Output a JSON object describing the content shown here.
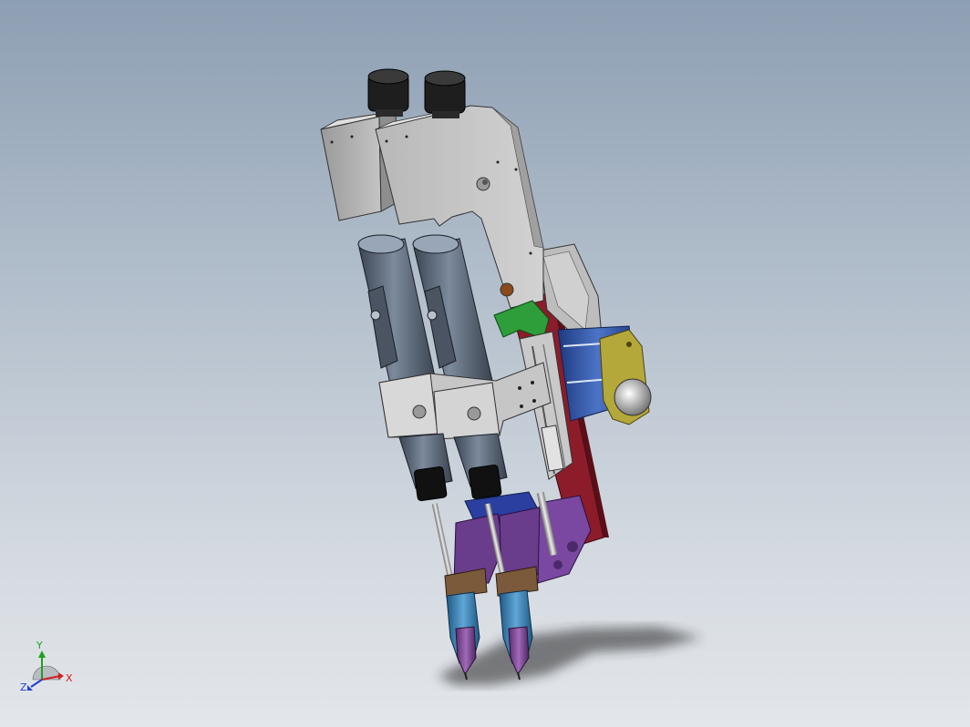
{
  "viewport": {
    "background_top": "#8d9fb3",
    "background_bottom": "#e3e6ea"
  },
  "model": {
    "frame_color": "#a8a8a8",
    "plate_color": "#8c1c2a",
    "bracket_color": "#6a3c8c",
    "motor_color": "#5b6878",
    "cylinder_color": "#2a4fa0",
    "flange_color": "#b5a83a",
    "bracket_accent_color": "#2d9e3a",
    "nozzle_color": "#3a7fb0"
  },
  "triad": {
    "x_label": "X",
    "y_label": "Y",
    "z_label": "Z",
    "x_color": "#d02020",
    "y_color": "#20a020",
    "z_color": "#2040d0"
  }
}
